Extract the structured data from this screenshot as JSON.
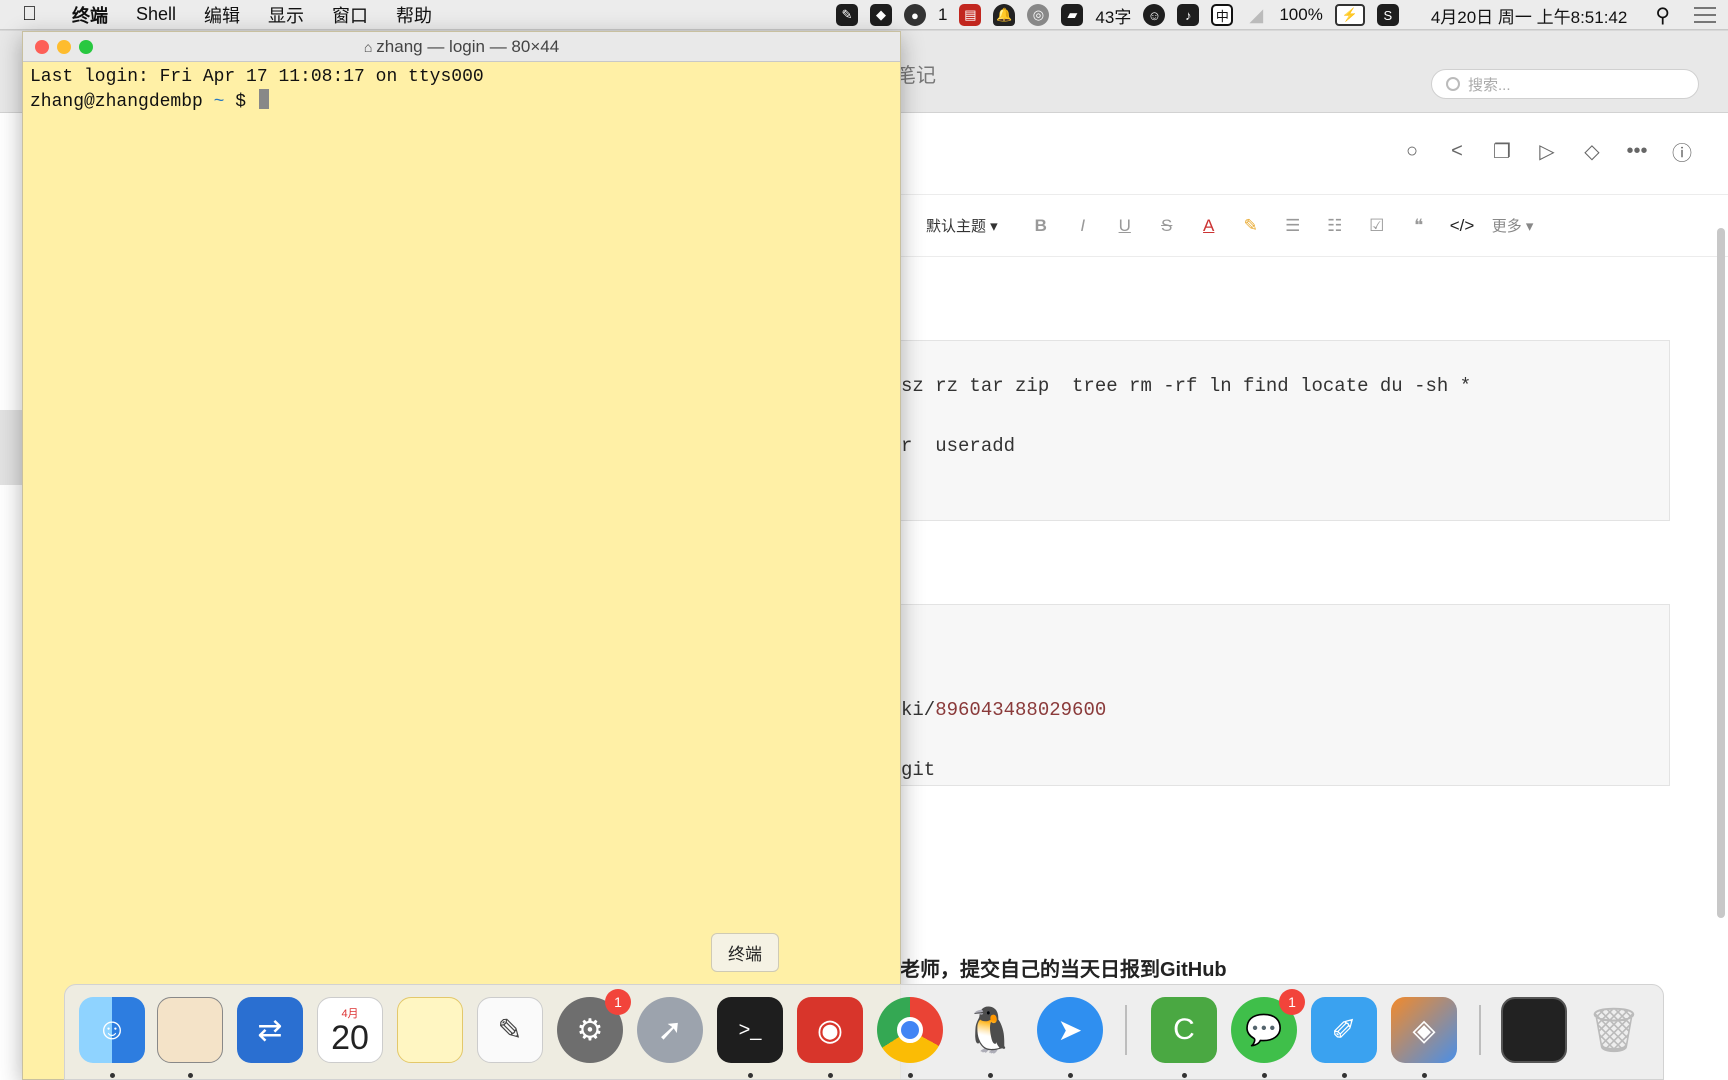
{
  "menubar": {
    "app_name": "终端",
    "items": [
      "Shell",
      "编辑",
      "显示",
      "窗口",
      "帮助"
    ],
    "wechat_count": "1",
    "char_count": "43字",
    "input_method": "中",
    "battery": "100%",
    "datetime": "4月20日 周一 上午8:51:42"
  },
  "notes": {
    "title_fragment": "笔记",
    "search_placeholder": "搜索...",
    "toolbar": {
      "theme": "默认主题",
      "more": "更多"
    },
    "code1": {
      "line1": "sz rz tar zip  tree rm -rf ln find locate du -sh *",
      "line2": "r  useradd"
    },
    "code2": {
      "line1_prefix": "ki/",
      "line1_link": "896043488029600",
      "line2": "git"
    },
    "paragraph": "老师，提交自己的当天日报到GitHub"
  },
  "terminal": {
    "title": "zhang — login — 80×44",
    "last_login": "Last login: Fri Apr 17 11:08:17 on ttys000",
    "prompt_user": "zhang@zhangdembp",
    "prompt_tilde": "~",
    "prompt_symbol": "$"
  },
  "dock": {
    "tooltip": "终端",
    "calendar_month": "4月",
    "calendar_day": "20",
    "prefs_badge": "1",
    "wechat_badge": "1"
  },
  "colors": {
    "terminal_bg": "#fff0a6",
    "accent_blue": "#2a7abf"
  }
}
